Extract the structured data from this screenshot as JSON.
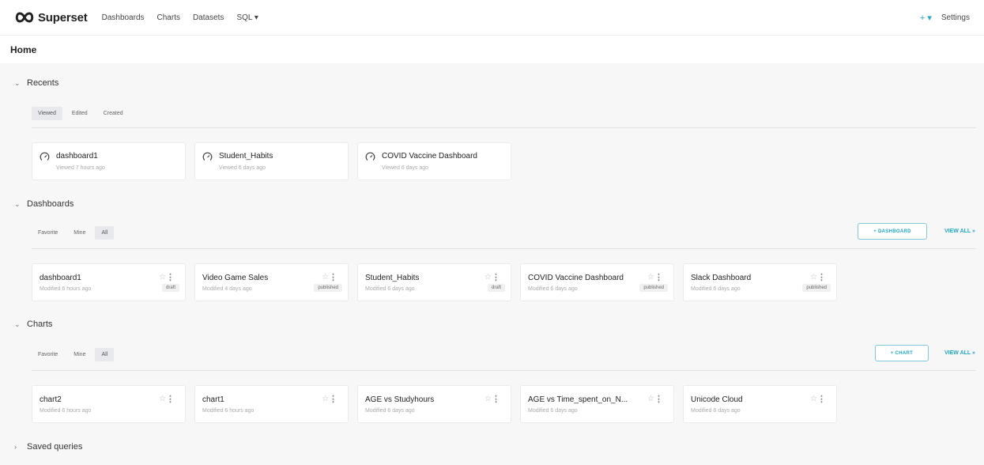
{
  "nav": {
    "brand": "Superset",
    "items": [
      "Dashboards",
      "Charts",
      "Datasets",
      "SQL ▾"
    ],
    "plus": "+ ▾",
    "settings": "Settings"
  },
  "page_title": "Home",
  "recents": {
    "label": "Recents",
    "tabs": [
      "Viewed",
      "Edited",
      "Created"
    ],
    "active_tab": "Viewed",
    "cards": [
      {
        "title": "dashboard1",
        "sub": "Viewed 7 hours ago"
      },
      {
        "title": "Student_Habits",
        "sub": "Viewed 6 days ago"
      },
      {
        "title": "COVID Vaccine Dashboard",
        "sub": "Viewed 6 days ago"
      }
    ]
  },
  "dashboards": {
    "label": "Dashboards",
    "tabs": [
      "Favorite",
      "Mine",
      "All"
    ],
    "active_tab": "All",
    "add_label": "+ DASHBOARD",
    "view_all": "VIEW ALL »",
    "cards": [
      {
        "title": "dashboard1",
        "sub": "Modified 6 hours ago",
        "badge": "draft"
      },
      {
        "title": "Video Game Sales",
        "sub": "Modified 4 days ago",
        "badge": "published"
      },
      {
        "title": "Student_Habits",
        "sub": "Modified 6 days ago",
        "badge": "draft"
      },
      {
        "title": "COVID Vaccine Dashboard",
        "sub": "Modified 6 days ago",
        "badge": "published"
      },
      {
        "title": "Slack Dashboard",
        "sub": "Modified 6 days ago",
        "badge": "published"
      }
    ]
  },
  "charts": {
    "label": "Charts",
    "tabs": [
      "Favorite",
      "Mine",
      "All"
    ],
    "active_tab": "All",
    "add_label": "+ CHART",
    "view_all": "VIEW ALL »",
    "cards": [
      {
        "title": "chart2",
        "sub": "Modified 6 hours ago"
      },
      {
        "title": "chart1",
        "sub": "Modified 6 hours ago"
      },
      {
        "title": "AGE vs Studyhours",
        "sub": "Modified 6 days ago"
      },
      {
        "title": "AGE vs Time_spent_on_N...",
        "sub": "Modified 6 days ago"
      },
      {
        "title": "Unicode Cloud",
        "sub": "Modified 6 days ago"
      }
    ]
  },
  "saved_queries": {
    "label": "Saved queries"
  },
  "icons": {
    "expanded": "chevron-down-icon",
    "collapsed": "chevron-right-icon",
    "dashboard": "gauge-icon",
    "favorite": "star-outline-icon",
    "more": "more-vertical-icon"
  },
  "colors": {
    "accent": "#20a7c9",
    "background": "#f7f7f7",
    "card": "#ffffff"
  }
}
